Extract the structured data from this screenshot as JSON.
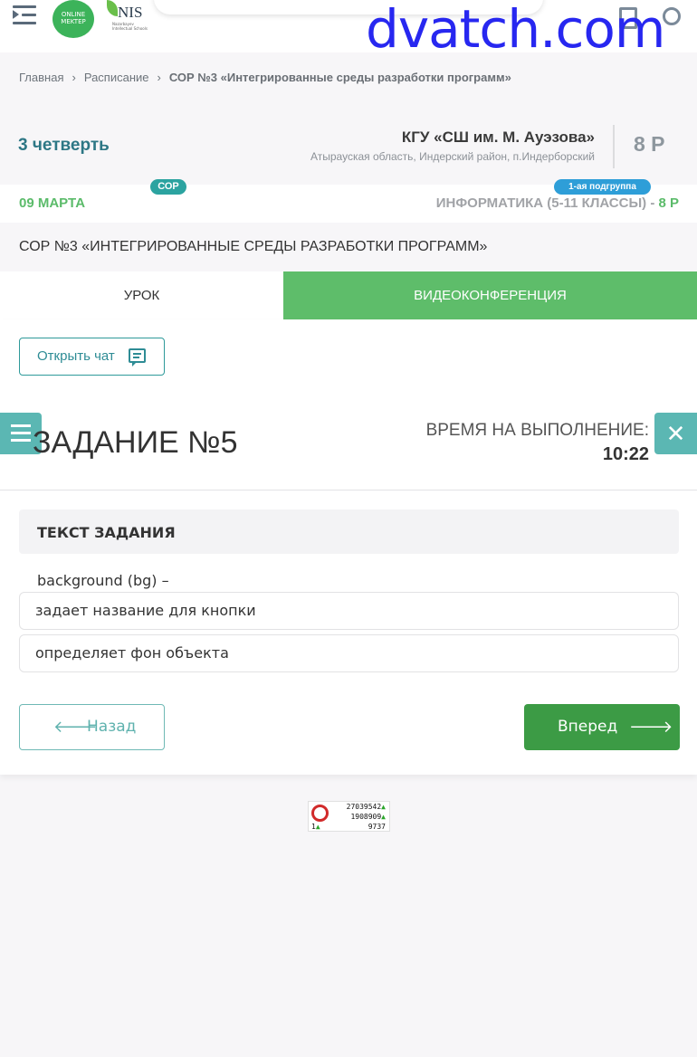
{
  "header": {
    "logo_online_mektep": "ONLINE MEKTEP",
    "logo_nis": "NIS",
    "logo_nis_sub": "Nazarbayev Intellectual Schools",
    "watermark": "dvatch.com"
  },
  "breadcrumb": {
    "home": "Главная",
    "schedule": "Расписание",
    "current": "СОР №3 «Интегрированные среды разработки программ»"
  },
  "info": {
    "quarter": "3 четверть",
    "school_name": "КГУ «СШ им. М. Ауэзова»",
    "school_address": "Атырауская область, Индерский район, п.Индерборский",
    "class": "8 Р"
  },
  "lesson": {
    "date": "09 МАРТА",
    "type_badge": "СОР",
    "group_badge": "1-ая подгруппа",
    "subject": "ИНФОРМАТИКА (5-11 КЛАССЫ) - ",
    "subject_class": "8 Р",
    "title": "СОР №3 «ИНТЕГРИРОВАННЫЕ СРЕДЫ РАЗРАБОТКИ ПРОГРАММ»"
  },
  "tabs": {
    "lesson": "УРОК",
    "video": "ВИДЕОКОНФЕРЕНЦИЯ"
  },
  "chat": {
    "label": "Открыть чат"
  },
  "task": {
    "title": "ЗАДАНИЕ №5",
    "time_label": "ВРЕМЯ НА ВЫПОЛНЕНИЕ:",
    "time_value": "10:22",
    "text_header": "ТЕКСТ ЗАДАНИЯ",
    "question": "background (bg) –",
    "options": [
      "задает название для кнопки",
      "определяет фон объекта"
    ]
  },
  "nav": {
    "back": "Назад",
    "next": "Вперед"
  },
  "counter": {
    "total": "27039542",
    "today": "1908909",
    "online": "9737",
    "rank": "1"
  },
  "colors": {
    "accent_green": "#5ebd6a",
    "teal": "#2ba3a0",
    "next_button": "#3c9b45",
    "group_badge": "#2e9ed8"
  }
}
